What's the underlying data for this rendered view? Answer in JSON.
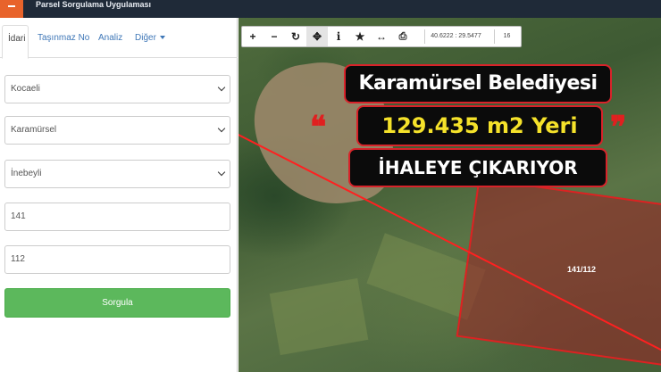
{
  "app": {
    "title": "Parsel Sorgulama Uygulaması"
  },
  "tabs": [
    {
      "label": "İdari"
    },
    {
      "label": "Taşınmaz No"
    },
    {
      "label": "Analiz"
    },
    {
      "label": "Diğer"
    }
  ],
  "form": {
    "il": "Kocaeli",
    "ilce": "Karamürsel",
    "mahalle": "İnebeyli",
    "ada": "141",
    "parsel": "112",
    "submit_label": "Sorgula"
  },
  "toolbar": {
    "coords": "40.6222 : 29.5477",
    "zoom": "16",
    "icons": [
      "zoom-in-icon",
      "zoom-out-icon",
      "refresh-icon",
      "pan-icon",
      "info-icon",
      "bookmark-icon",
      "measure-icon",
      "print-icon"
    ]
  },
  "map": {
    "parcel_label": "141/112"
  },
  "headline": {
    "line1": "Karamürsel Belediyesi",
    "line2": "129.435 m2 Yeri",
    "line3": "İHALEYE ÇIKARIYOR"
  },
  "colors": {
    "header": "#1f2a38",
    "accent": "#e8632b",
    "submit": "#5cb85c",
    "headline_red": "#d8232a",
    "headline_yellow": "#f5e22a"
  }
}
